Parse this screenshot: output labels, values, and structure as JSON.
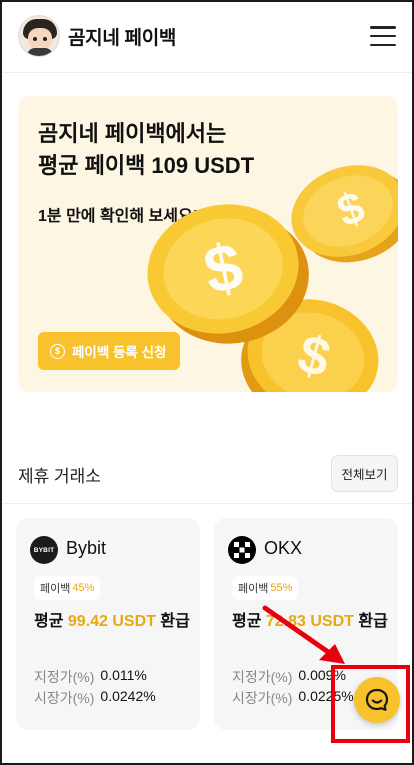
{
  "header": {
    "brand": "곰지네 페이백",
    "avatar_icon": "avatar-icon",
    "menu_icon": "hamburger-menu-icon"
  },
  "banner": {
    "title_line1": "곰지네 페이백에서는",
    "title_line2": "평균 페이백 109 USDT",
    "subtitle": "1분 만에 확인해 보세요!",
    "cta_label": "페이백 등록 신청",
    "cta_icon": "dollar-circle-icon",
    "cta_icon_glyph": "$",
    "illustration": "gold-coins-icon"
  },
  "partners": {
    "title": "제휴 거래소",
    "view_all": "전체보기",
    "cards": [
      {
        "name": "Bybit",
        "logo_icon": "bybit-logo-icon",
        "logo_text": "BYBIT",
        "badge_label": "페이백",
        "badge_pct": "45%",
        "avg_prefix": "평균 ",
        "avg_value": "99.42 USDT",
        "avg_suffix": " 환급",
        "maker_label": "지정가(%)",
        "maker_value": "0.011%",
        "taker_label": "시장가(%)",
        "taker_value": "0.0242%"
      },
      {
        "name": "OKX",
        "logo_icon": "okx-logo-icon",
        "badge_label": "페이백",
        "badge_pct": "55%",
        "avg_prefix": "평균 ",
        "avg_value": "72.83 USDT",
        "avg_suffix": " 환급",
        "maker_label": "지정가(%)",
        "maker_value": "0.009%",
        "taker_label": "시장가(%)",
        "taker_value": "0.0225%"
      }
    ]
  },
  "floating": {
    "chat_icon": "chat-bubble-icon"
  },
  "colors": {
    "accent": "#f7c22b",
    "accent_text": "#e7a90f",
    "banner_bg": "#fdf6e3",
    "annotation": "#e8000e"
  }
}
